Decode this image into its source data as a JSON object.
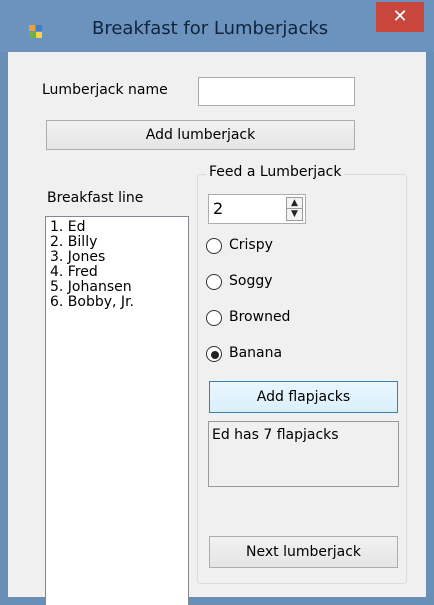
{
  "window": {
    "title": "Breakfast for Lumberjacks",
    "close_glyph": "✕"
  },
  "lumberjack_name": {
    "label": "Lumberjack name",
    "value": ""
  },
  "add_lumberjack": {
    "label": "Add lumberjack"
  },
  "breakfast_line": {
    "label": "Breakfast line",
    "items": [
      "1. Ed",
      "2. Billy",
      "3. Jones",
      "4. Fred",
      "5. Johansen",
      "6. Bobby, Jr."
    ]
  },
  "feed": {
    "title": "Feed a Lumberjack",
    "quantity": "2",
    "options": [
      {
        "label": "Crispy",
        "selected": false
      },
      {
        "label": "Soggy",
        "selected": false
      },
      {
        "label": "Browned",
        "selected": false
      },
      {
        "label": "Banana",
        "selected": true
      }
    ],
    "add_flapjacks_label": "Add flapjacks",
    "status_text": "Ed has 7 flapjacks",
    "next_label": "Next lumberjack"
  },
  "colors": {
    "titlebar": "#6c93bd",
    "close_button": "#c9463d",
    "client_bg": "#f0f0f0"
  }
}
